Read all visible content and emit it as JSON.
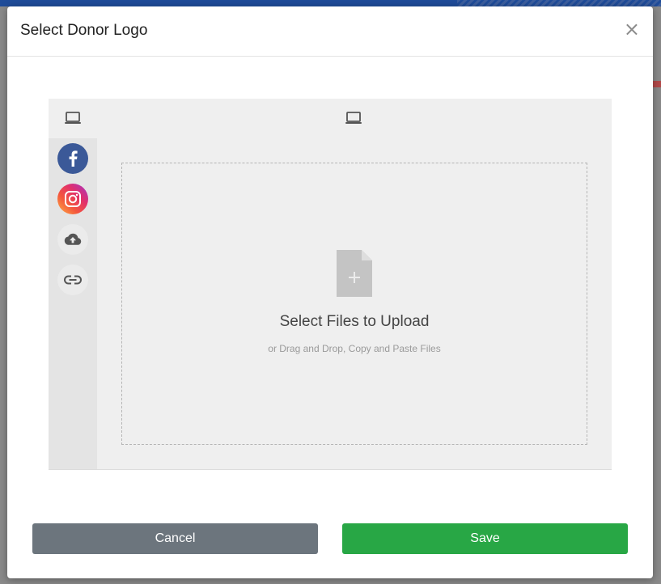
{
  "modal": {
    "title": "Select Donor Logo",
    "close_glyph": "×"
  },
  "picker": {
    "tabs_icon": "laptop-icon",
    "sources": [
      {
        "name": "facebook",
        "icon": "facebook-icon",
        "color": "#3b5998"
      },
      {
        "name": "instagram",
        "icon": "instagram-icon",
        "color": "#e1306c"
      },
      {
        "name": "cloud-upload",
        "icon": "cloud-upload-icon",
        "color": "#e8e8e8"
      },
      {
        "name": "link",
        "icon": "link-icon",
        "color": "#e8e8e8"
      }
    ],
    "drop_title": "Select Files to Upload",
    "drop_subtitle": "or Drag and Drop, Copy and Paste Files",
    "file_icon": "file-add-icon"
  },
  "footer": {
    "cancel_label": "Cancel",
    "save_label": "Save"
  },
  "colors": {
    "cancel": "#6c757d",
    "save": "#28a745",
    "brand_bar": "#1f4c99"
  }
}
